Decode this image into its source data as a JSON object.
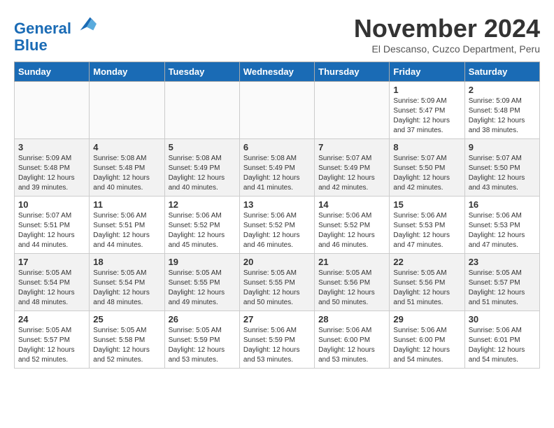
{
  "header": {
    "logo_line1": "General",
    "logo_line2": "Blue",
    "month": "November 2024",
    "location": "El Descanso, Cuzco Department, Peru"
  },
  "weekdays": [
    "Sunday",
    "Monday",
    "Tuesday",
    "Wednesday",
    "Thursday",
    "Friday",
    "Saturday"
  ],
  "weeks": [
    [
      {
        "day": "",
        "info": ""
      },
      {
        "day": "",
        "info": ""
      },
      {
        "day": "",
        "info": ""
      },
      {
        "day": "",
        "info": ""
      },
      {
        "day": "",
        "info": ""
      },
      {
        "day": "1",
        "info": "Sunrise: 5:09 AM\nSunset: 5:47 PM\nDaylight: 12 hours\nand 37 minutes."
      },
      {
        "day": "2",
        "info": "Sunrise: 5:09 AM\nSunset: 5:48 PM\nDaylight: 12 hours\nand 38 minutes."
      }
    ],
    [
      {
        "day": "3",
        "info": "Sunrise: 5:09 AM\nSunset: 5:48 PM\nDaylight: 12 hours\nand 39 minutes."
      },
      {
        "day": "4",
        "info": "Sunrise: 5:08 AM\nSunset: 5:48 PM\nDaylight: 12 hours\nand 40 minutes."
      },
      {
        "day": "5",
        "info": "Sunrise: 5:08 AM\nSunset: 5:49 PM\nDaylight: 12 hours\nand 40 minutes."
      },
      {
        "day": "6",
        "info": "Sunrise: 5:08 AM\nSunset: 5:49 PM\nDaylight: 12 hours\nand 41 minutes."
      },
      {
        "day": "7",
        "info": "Sunrise: 5:07 AM\nSunset: 5:49 PM\nDaylight: 12 hours\nand 42 minutes."
      },
      {
        "day": "8",
        "info": "Sunrise: 5:07 AM\nSunset: 5:50 PM\nDaylight: 12 hours\nand 42 minutes."
      },
      {
        "day": "9",
        "info": "Sunrise: 5:07 AM\nSunset: 5:50 PM\nDaylight: 12 hours\nand 43 minutes."
      }
    ],
    [
      {
        "day": "10",
        "info": "Sunrise: 5:07 AM\nSunset: 5:51 PM\nDaylight: 12 hours\nand 44 minutes."
      },
      {
        "day": "11",
        "info": "Sunrise: 5:06 AM\nSunset: 5:51 PM\nDaylight: 12 hours\nand 44 minutes."
      },
      {
        "day": "12",
        "info": "Sunrise: 5:06 AM\nSunset: 5:52 PM\nDaylight: 12 hours\nand 45 minutes."
      },
      {
        "day": "13",
        "info": "Sunrise: 5:06 AM\nSunset: 5:52 PM\nDaylight: 12 hours\nand 46 minutes."
      },
      {
        "day": "14",
        "info": "Sunrise: 5:06 AM\nSunset: 5:52 PM\nDaylight: 12 hours\nand 46 minutes."
      },
      {
        "day": "15",
        "info": "Sunrise: 5:06 AM\nSunset: 5:53 PM\nDaylight: 12 hours\nand 47 minutes."
      },
      {
        "day": "16",
        "info": "Sunrise: 5:06 AM\nSunset: 5:53 PM\nDaylight: 12 hours\nand 47 minutes."
      }
    ],
    [
      {
        "day": "17",
        "info": "Sunrise: 5:05 AM\nSunset: 5:54 PM\nDaylight: 12 hours\nand 48 minutes."
      },
      {
        "day": "18",
        "info": "Sunrise: 5:05 AM\nSunset: 5:54 PM\nDaylight: 12 hours\nand 48 minutes."
      },
      {
        "day": "19",
        "info": "Sunrise: 5:05 AM\nSunset: 5:55 PM\nDaylight: 12 hours\nand 49 minutes."
      },
      {
        "day": "20",
        "info": "Sunrise: 5:05 AM\nSunset: 5:55 PM\nDaylight: 12 hours\nand 50 minutes."
      },
      {
        "day": "21",
        "info": "Sunrise: 5:05 AM\nSunset: 5:56 PM\nDaylight: 12 hours\nand 50 minutes."
      },
      {
        "day": "22",
        "info": "Sunrise: 5:05 AM\nSunset: 5:56 PM\nDaylight: 12 hours\nand 51 minutes."
      },
      {
        "day": "23",
        "info": "Sunrise: 5:05 AM\nSunset: 5:57 PM\nDaylight: 12 hours\nand 51 minutes."
      }
    ],
    [
      {
        "day": "24",
        "info": "Sunrise: 5:05 AM\nSunset: 5:57 PM\nDaylight: 12 hours\nand 52 minutes."
      },
      {
        "day": "25",
        "info": "Sunrise: 5:05 AM\nSunset: 5:58 PM\nDaylight: 12 hours\nand 52 minutes."
      },
      {
        "day": "26",
        "info": "Sunrise: 5:05 AM\nSunset: 5:59 PM\nDaylight: 12 hours\nand 53 minutes."
      },
      {
        "day": "27",
        "info": "Sunrise: 5:06 AM\nSunset: 5:59 PM\nDaylight: 12 hours\nand 53 minutes."
      },
      {
        "day": "28",
        "info": "Sunrise: 5:06 AM\nSunset: 6:00 PM\nDaylight: 12 hours\nand 53 minutes."
      },
      {
        "day": "29",
        "info": "Sunrise: 5:06 AM\nSunset: 6:00 PM\nDaylight: 12 hours\nand 54 minutes."
      },
      {
        "day": "30",
        "info": "Sunrise: 5:06 AM\nSunset: 6:01 PM\nDaylight: 12 hours\nand 54 minutes."
      }
    ]
  ]
}
